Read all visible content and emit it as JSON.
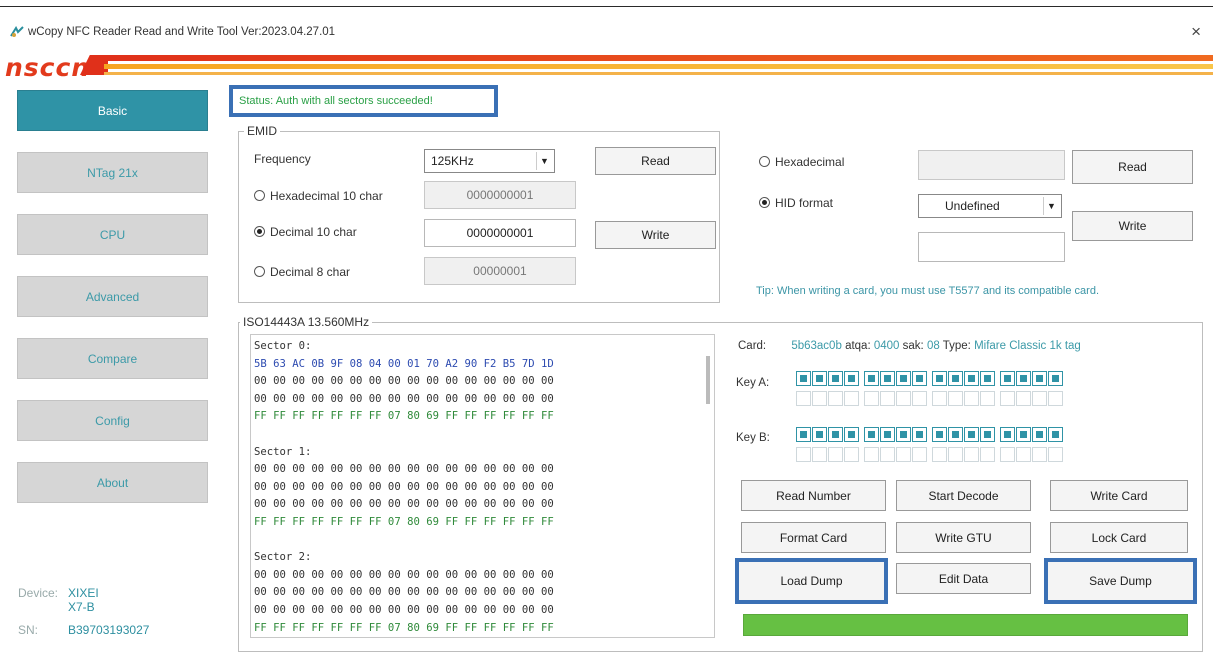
{
  "window": {
    "title": "wCopy NFC Reader Read and Write Tool  Ver:2023.04.27.01",
    "close": "×",
    "logo": "nsccn"
  },
  "sidebar": {
    "items": [
      {
        "label": "Basic",
        "active": true
      },
      {
        "label": "NTag 21x",
        "active": false
      },
      {
        "label": "CPU",
        "active": false
      },
      {
        "label": "Advanced",
        "active": false
      },
      {
        "label": "Compare",
        "active": false
      },
      {
        "label": "Config",
        "active": false
      },
      {
        "label": "About",
        "active": false
      }
    ],
    "device_label": "Device:",
    "device_value": "XIXEI X7-B",
    "sn_label": "SN:",
    "sn_value": "B39703193027"
  },
  "status": {
    "text": "Status: Auth with all sectors succeeded!"
  },
  "emid": {
    "group_title": "EMID",
    "frequency_label": "Frequency",
    "frequency_value": "125KHz",
    "read_button": "Read",
    "write_button": "Write",
    "hex10_label": "Hexadecimal 10 char",
    "hex10_value": "0000000001",
    "dec10_label": "Decimal 10 char",
    "dec10_value": "0000000001",
    "dec8_label": "Decimal 8 char",
    "dec8_value": "00000001",
    "selected": "dec10"
  },
  "right_panel": {
    "hex_label": "Hexadecimal",
    "hex_value": "",
    "read_button": "Read",
    "hid_label": "HID format",
    "hid_value": "Undefined",
    "hid_input": "",
    "write_button": "Write",
    "selected": "hid",
    "tip": "Tip: When writing a card, you must use T5577 and its compatible card."
  },
  "iso": {
    "group_title": "ISO14443A 13.560MHz",
    "hex_lines": [
      {
        "text": "Sector 0:",
        "style": "plain"
      },
      {
        "text": "5B 63 AC 0B 9F 08 04 00 01 70 A2 90 F2 B5 7D 1D",
        "style": "blue"
      },
      {
        "text": "00 00 00 00 00 00 00 00 00 00 00 00 00 00 00 00",
        "style": "plain"
      },
      {
        "text": "00 00 00 00 00 00 00 00 00 00 00 00 00 00 00 00",
        "style": "plain"
      },
      {
        "text": "FF FF FF FF FF FF FF 07 80 69 FF FF FF FF FF FF",
        "style": "green"
      },
      {
        "text": "",
        "style": "plain"
      },
      {
        "text": "Sector 1:",
        "style": "plain"
      },
      {
        "text": "00 00 00 00 00 00 00 00 00 00 00 00 00 00 00 00",
        "style": "plain"
      },
      {
        "text": "00 00 00 00 00 00 00 00 00 00 00 00 00 00 00 00",
        "style": "plain"
      },
      {
        "text": "00 00 00 00 00 00 00 00 00 00 00 00 00 00 00 00",
        "style": "plain"
      },
      {
        "text": "FF FF FF FF FF FF FF 07 80 69 FF FF FF FF FF FF",
        "style": "green"
      },
      {
        "text": "",
        "style": "plain"
      },
      {
        "text": "Sector 2:",
        "style": "plain"
      },
      {
        "text": "00 00 00 00 00 00 00 00 00 00 00 00 00 00 00 00",
        "style": "plain"
      },
      {
        "text": "00 00 00 00 00 00 00 00 00 00 00 00 00 00 00 00",
        "style": "plain"
      },
      {
        "text": "00 00 00 00 00 00 00 00 00 00 00 00 00 00 00 00",
        "style": "plain"
      },
      {
        "text": "FF FF FF FF FF FF FF 07 80 69 FF FF FF FF FF FF",
        "style": "green"
      }
    ],
    "card_label": "Card:",
    "card_uid": "5b63ac0b",
    "atqa_label": "atqa:",
    "atqa_value": "0400",
    "sak_label": "sak:",
    "sak_value": "08",
    "type_label": "Type:",
    "type_value": "Mifare Classic 1k tag",
    "key_a_label": "Key A:",
    "key_b_label": "Key B:",
    "key_a_found": 16,
    "key_b_found": 16,
    "sector_count": 16,
    "buttons": {
      "read_number": "Read Number",
      "start_decode": "Start Decode",
      "write_card": "Write Card",
      "format_card": "Format Card",
      "write_gtu": "Write GTU",
      "lock_card": "Lock Card",
      "load_dump": "Load Dump",
      "edit_data": "Edit Data",
      "save_dump": "Save Dump"
    },
    "progress": 1.0
  },
  "colors": {
    "accent": "#2f93a6",
    "status_green": "#2aa046",
    "highlight_blue": "#3a70b5",
    "progress_green": "#66c043",
    "logo_red": "#e23a1c"
  }
}
